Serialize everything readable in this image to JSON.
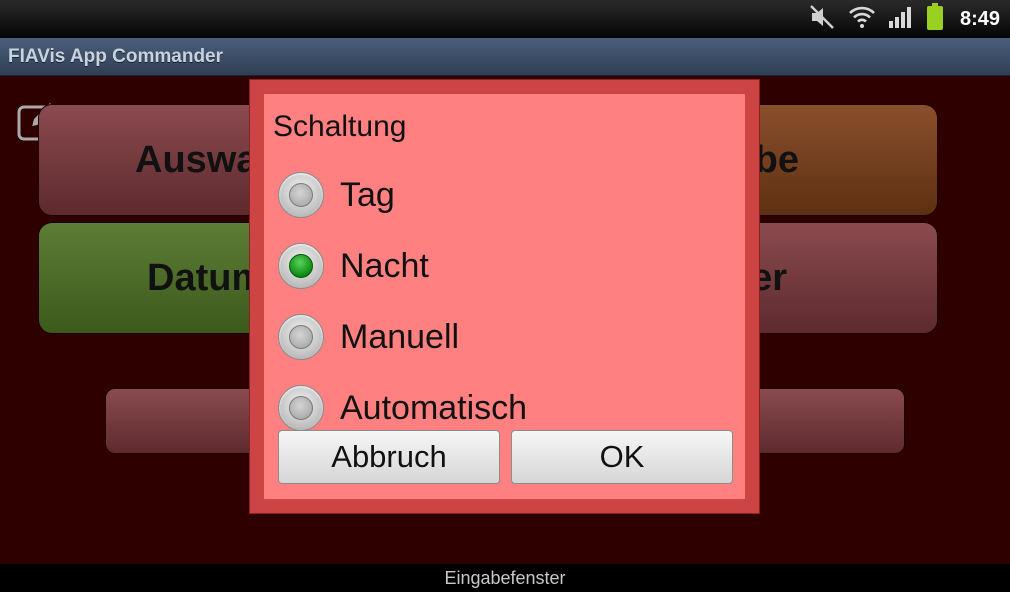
{
  "status_bar": {
    "time": "8:49",
    "icons": [
      "mute-icon",
      "wifi-icon",
      "signal-icon",
      "battery-icon"
    ]
  },
  "app": {
    "title": "FIAVis App Commander"
  },
  "main": {
    "buttons": [
      {
        "id": "auswahl",
        "label": "Auswa",
        "color": "#7a3c40"
      },
      {
        "id": "ausgabe",
        "label": "be",
        "color": "#7a4020"
      },
      {
        "id": "datum",
        "label": "Datum",
        "color": "#4e6e2a"
      },
      {
        "id": "timer",
        "label": "er",
        "color": "#7a3c40"
      },
      {
        "id": "bottom",
        "label": "",
        "color": "#7a3c40"
      }
    ],
    "edit_icon": "edit-icon"
  },
  "dialog": {
    "title": "Schaltung",
    "options": [
      {
        "label": "Tag",
        "checked": false
      },
      {
        "label": "Nacht",
        "checked": true
      },
      {
        "label": "Manuell",
        "checked": false
      },
      {
        "label": "Automatisch",
        "checked": false
      }
    ],
    "cancel_label": "Abbruch",
    "ok_label": "OK",
    "colors": {
      "frame": "#cc4444",
      "body": "#ff8080",
      "selected": "#1a9a1a"
    }
  },
  "bottom_bar": {
    "label": "Eingabefenster"
  }
}
